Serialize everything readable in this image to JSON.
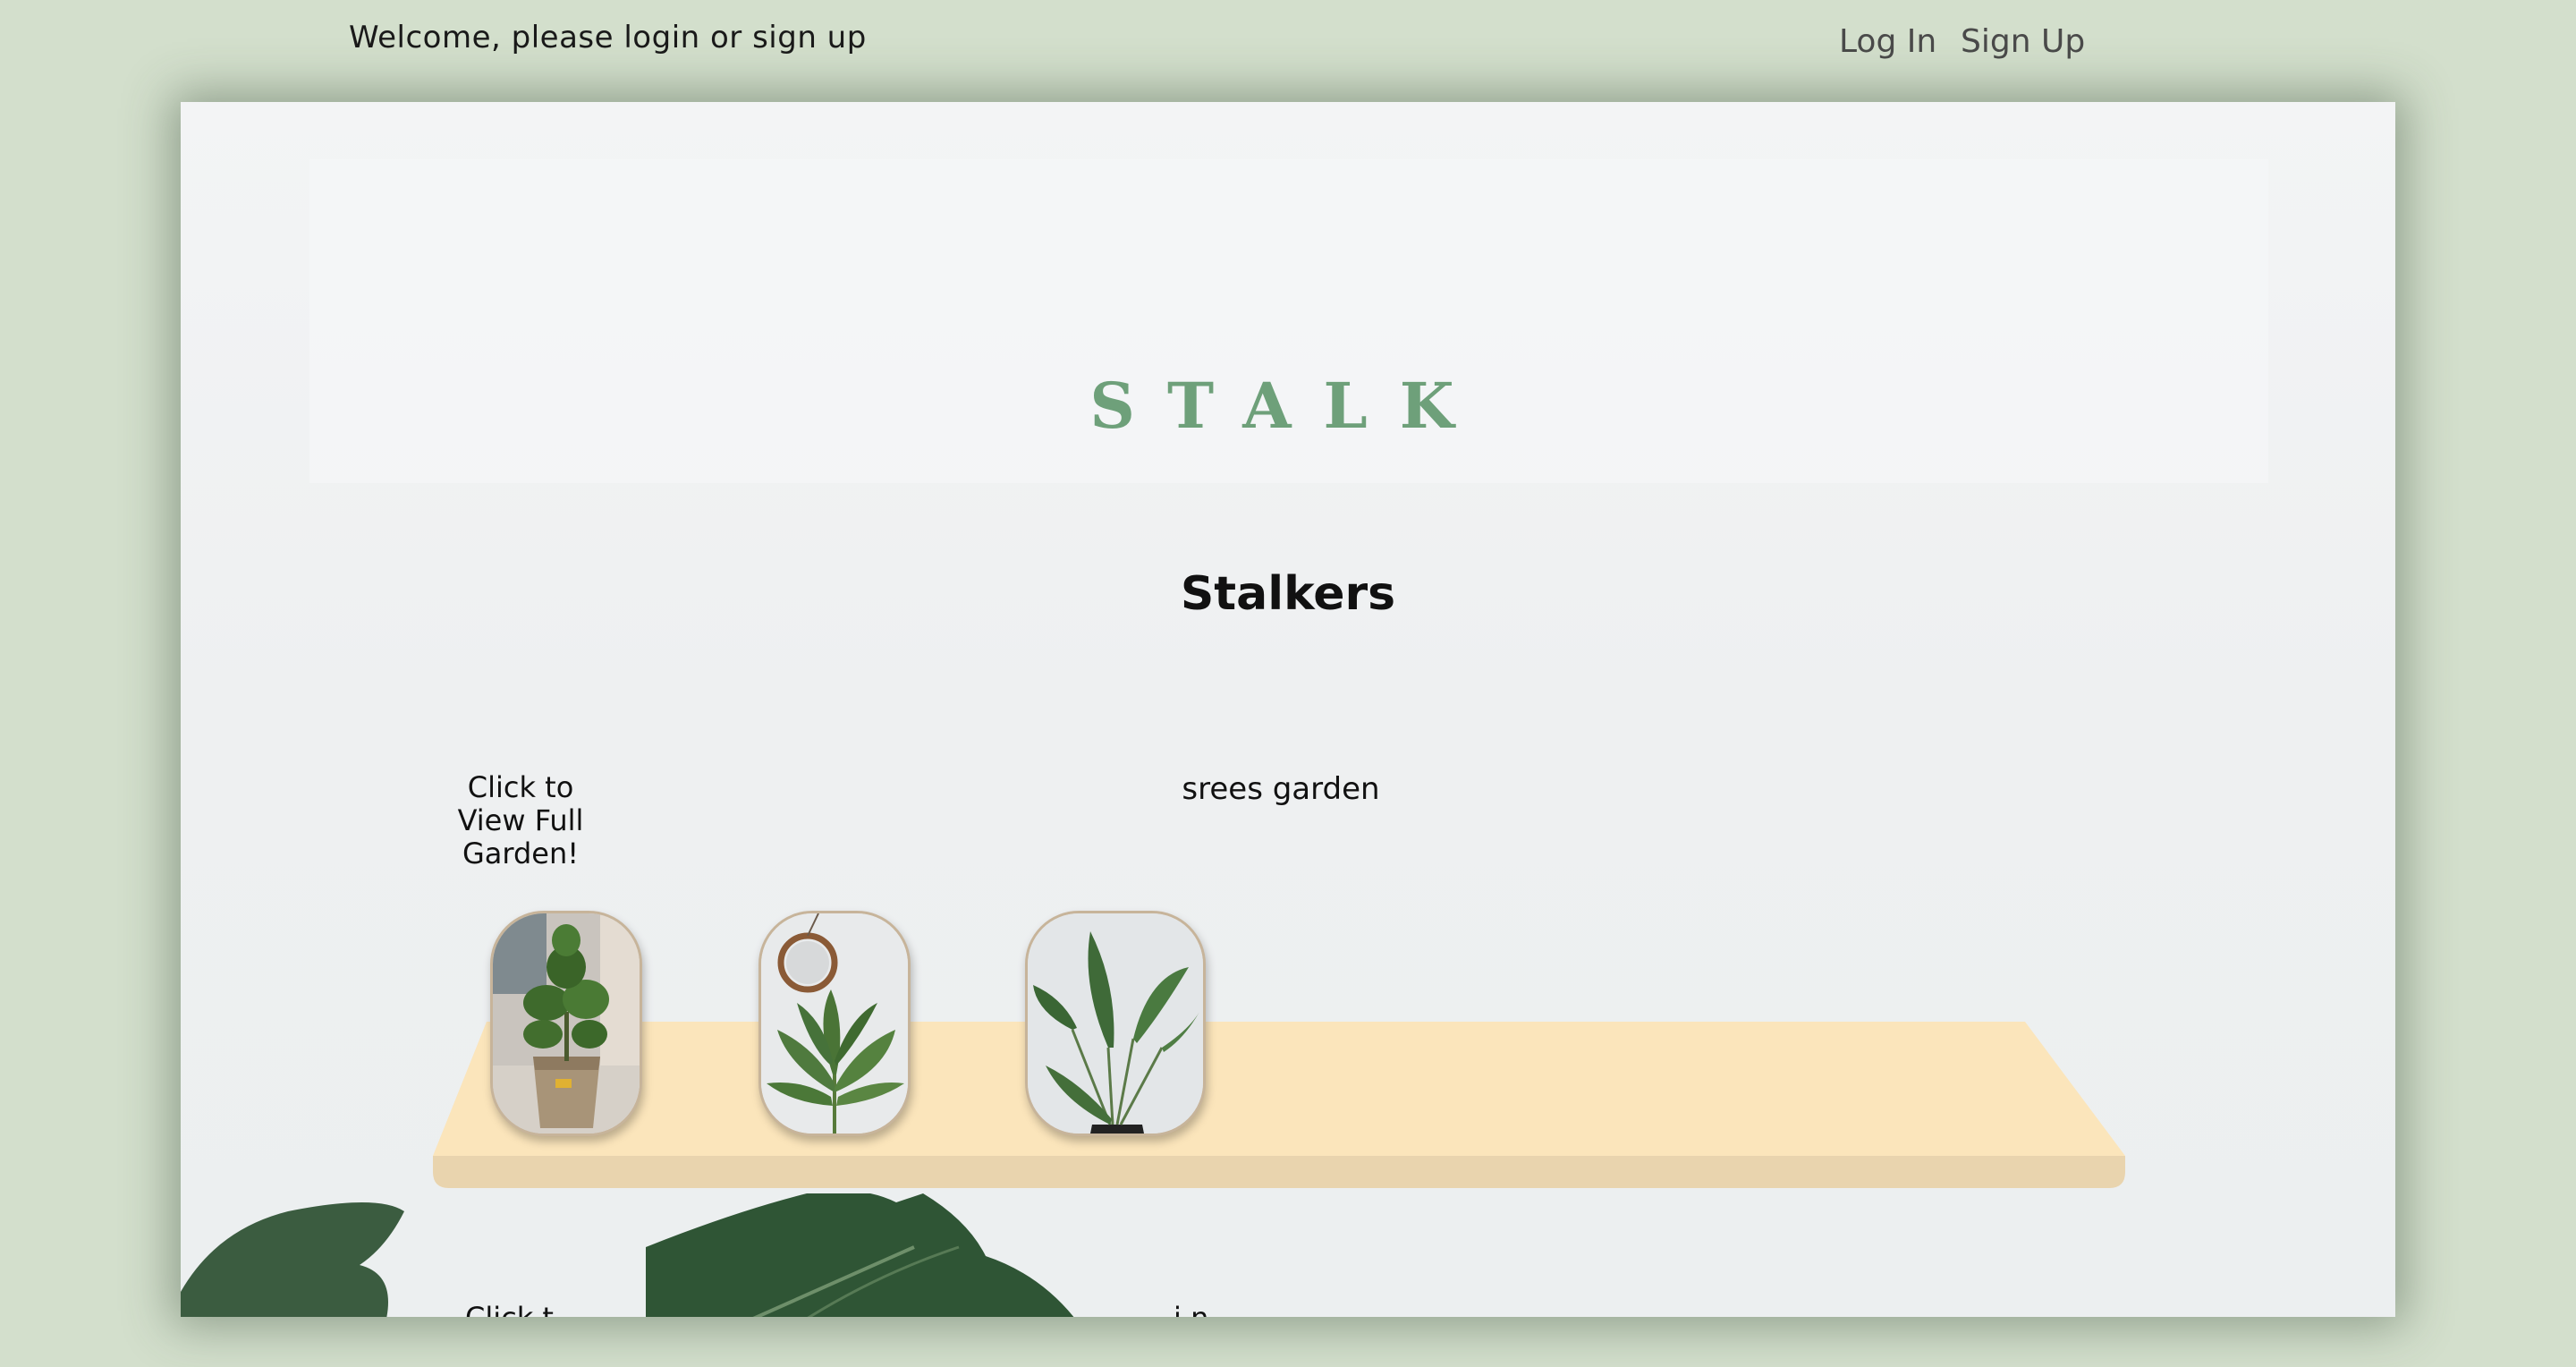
{
  "topbar": {
    "welcome_text": "Welcome, please login or sign up",
    "login_label": "Log In",
    "signup_label": "Sign Up"
  },
  "brand": {
    "logo_text": "STALK",
    "accent_color": "#6ea07a"
  },
  "page": {
    "section_title": "Stalkers"
  },
  "gardens": [
    {
      "link_text": "Click to View Full Garden!",
      "owner_label": "srees garden",
      "plants": [
        {
          "icon": "fiddle-leaf-fig-photo"
        },
        {
          "icon": "peace-lily-photo"
        },
        {
          "icon": "bird-of-paradise-photo"
        }
      ]
    },
    {
      "link_text": "Click t",
      "owner_label": "i           n"
    }
  ],
  "colors": {
    "background": "#d3dfcc",
    "shelf_top": "#fbe5bb",
    "shelf_edge": "#e9d4ae",
    "card_border": "#c7b49a"
  }
}
